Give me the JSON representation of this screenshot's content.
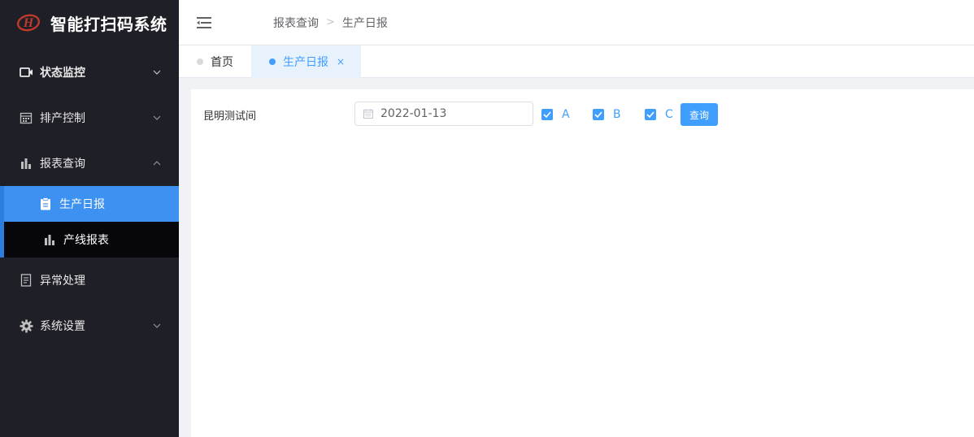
{
  "app": {
    "title": "智能打扫码系统"
  },
  "sidebar": {
    "items": [
      {
        "label": "状态监控",
        "icon": "video-camera-icon",
        "arrow": "down"
      },
      {
        "label": "排产控制",
        "icon": "calendar-icon",
        "arrow": "down"
      },
      {
        "label": "报表查询",
        "icon": "bar-chart-icon",
        "arrow": "up"
      },
      {
        "label": "异常处理",
        "icon": "document-icon",
        "arrow": ""
      },
      {
        "label": "系统设置",
        "icon": "gear-icon",
        "arrow": "down"
      }
    ],
    "subitems": [
      {
        "label": "生产日报",
        "icon": "clipboard-icon",
        "active": true
      },
      {
        "label": "产线报表",
        "icon": "bar-chart-icon",
        "active": false
      }
    ]
  },
  "header": {
    "breadcrumb": [
      "报表查询",
      "生产日报"
    ],
    "separator": ">"
  },
  "tabs": [
    {
      "label": "首页",
      "active": false
    },
    {
      "label": "生产日报",
      "active": true,
      "close": "×"
    }
  ],
  "filter": {
    "workshop": "昆明测试间",
    "date": "2022-01-13",
    "checkboxes": [
      {
        "label": "A",
        "checked": true
      },
      {
        "label": "B",
        "checked": true
      },
      {
        "label": "C",
        "checked": true
      }
    ],
    "query_label": "查询"
  },
  "colors": {
    "sidebar_bg": "#1f1f27",
    "accent": "#409eff",
    "active_menu": "#3d91f0"
  }
}
